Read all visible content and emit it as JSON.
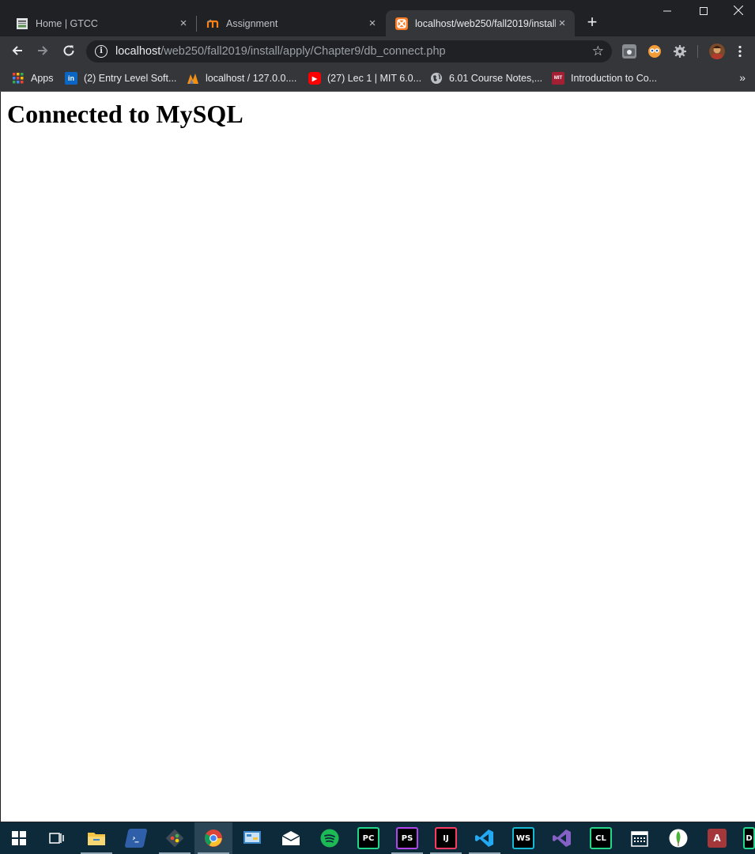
{
  "tabs": [
    {
      "title": "Home | GTCC",
      "icon": "gtcc-favicon-icon",
      "close": "×"
    },
    {
      "title": "Assignment",
      "icon": "moodle-favicon-icon",
      "close": "×"
    },
    {
      "title": "localhost/web250/fall2019/install",
      "icon": "xampp-favicon-icon",
      "close": "×",
      "active": true
    }
  ],
  "new_tab": "+",
  "window_controls": {
    "minimize": "—",
    "maximize": "☐",
    "close": "✕"
  },
  "nav": {
    "back": "←",
    "forward": "→",
    "reload": "↻"
  },
  "address": {
    "host": "localhost",
    "path": "/web250/fall2019/install/apply/Chapter9/db_connect.php",
    "info": "i",
    "star": "☆"
  },
  "bookmarks": [
    {
      "label": "Apps",
      "icon": "apps-grid-icon"
    },
    {
      "label": "(2) Entry Level Soft...",
      "icon": "linkedin-icon",
      "icon_text": "in"
    },
    {
      "label": "localhost / 127.0.0....",
      "icon": "phpmyadmin-icon",
      "icon_text": ""
    },
    {
      "label": "(27) Lec 1 | MIT 6.0...",
      "icon": "youtube-icon",
      "icon_text": "▶"
    },
    {
      "label": "6.01 Course Notes,...",
      "icon": "globe-icon",
      "icon_text": ""
    },
    {
      "label": "Introduction to Co...",
      "icon": "mit-ocw-icon",
      "icon_text": "MIT"
    }
  ],
  "bookmarks_more": "»",
  "page": {
    "heading": "Connected to MySQL"
  },
  "taskbar": [
    {
      "name": "start-icon",
      "text": "",
      "color": "#ffffff"
    },
    {
      "name": "task-view-icon",
      "text": "",
      "color": "#ffffff"
    },
    {
      "name": "file-explorer-icon",
      "text": "",
      "color": "#f4c542"
    },
    {
      "name": "powershell-icon",
      "text": "›_",
      "color": "#2e5fa8"
    },
    {
      "name": "git-icon",
      "text": "",
      "color": "#3f4b55"
    },
    {
      "name": "chrome-icon",
      "text": "",
      "color": "#db4437"
    },
    {
      "name": "control-panel-icon",
      "text": "",
      "color": "#3b87c8"
    },
    {
      "name": "mail-icon",
      "text": "",
      "color": "#ffffff"
    },
    {
      "name": "spotify-icon",
      "text": "",
      "color": "#1db954"
    },
    {
      "name": "pycharm-icon",
      "text": "PC",
      "color": "#21d789"
    },
    {
      "name": "phpstorm-icon",
      "text": "PS",
      "color": "#b345f1"
    },
    {
      "name": "intellij-icon",
      "text": "IJ",
      "color": "#fc3a64"
    },
    {
      "name": "vscode-icon",
      "text": "",
      "color": "#23a9f2"
    },
    {
      "name": "webstorm-icon",
      "text": "WS",
      "color": "#16b9d4"
    },
    {
      "name": "visual-studio-icon",
      "text": "",
      "color": "#8661c5"
    },
    {
      "name": "clion-icon",
      "text": "CL",
      "color": "#21d789"
    },
    {
      "name": "calendar-icon",
      "text": "",
      "color": "#ffffff"
    },
    {
      "name": "mongodb-icon",
      "text": "",
      "color": "#4db33d"
    },
    {
      "name": "access-icon",
      "text": "A",
      "color": "#a4373a"
    },
    {
      "name": "datagrip-icon",
      "text": "D",
      "color": "#22d88f"
    }
  ]
}
